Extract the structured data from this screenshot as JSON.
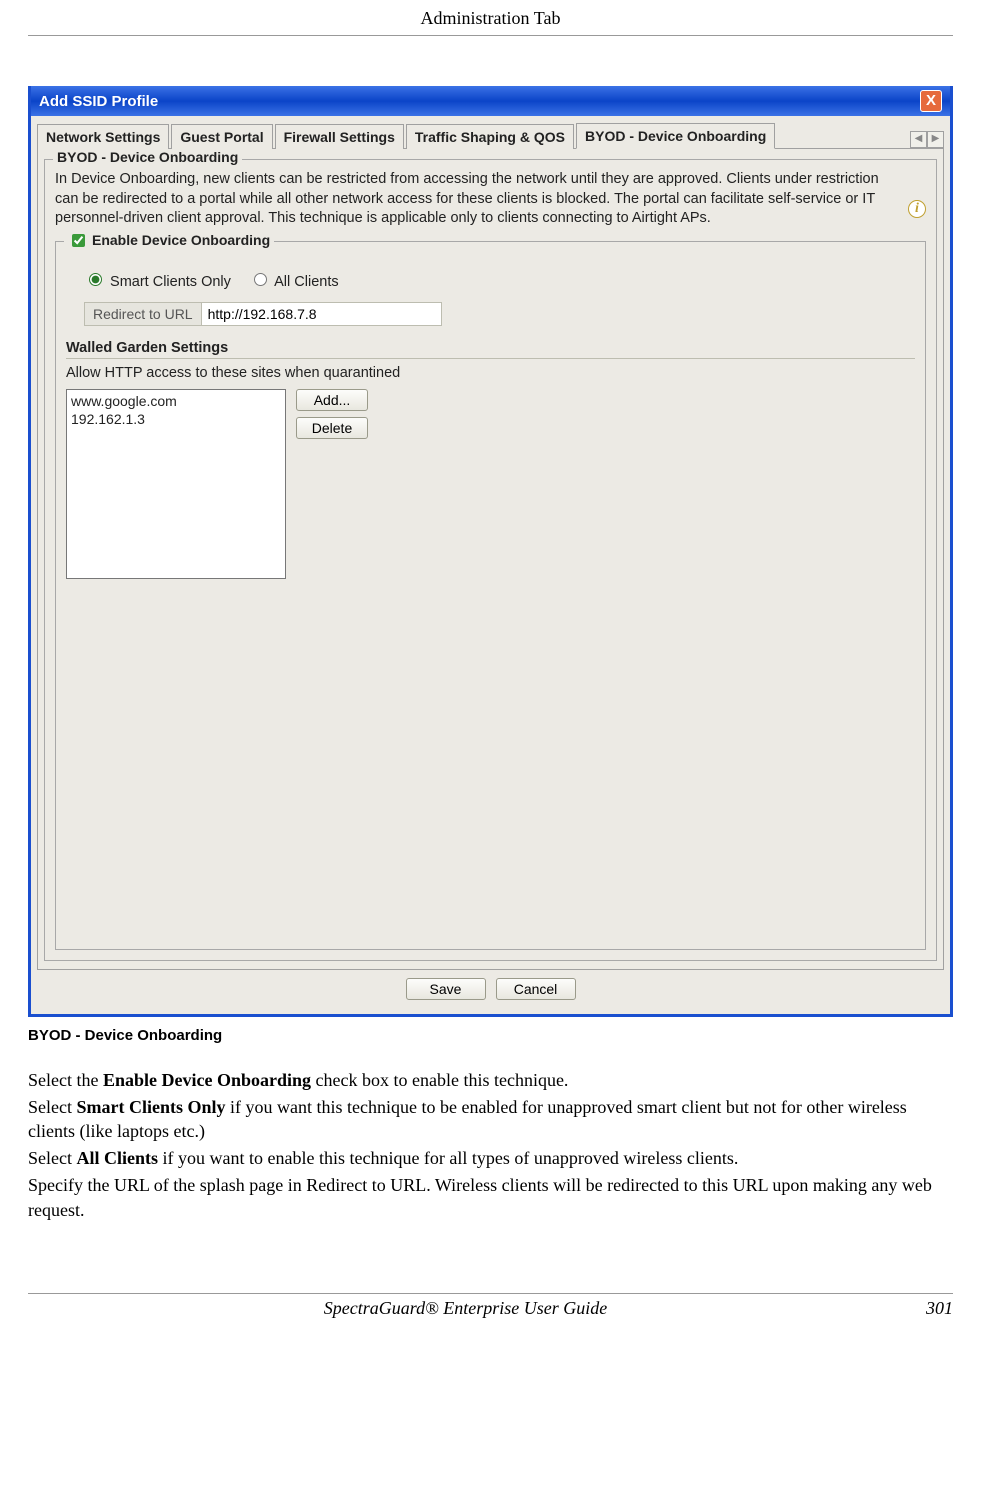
{
  "page_header": "Administration Tab",
  "dialog": {
    "title": "Add SSID Profile",
    "tabs": [
      "Network Settings",
      "Guest Portal",
      "Firewall Settings",
      "Traffic Shaping & QOS",
      "BYOD - Device Onboarding"
    ],
    "active_tab": "BYOD - Device Onboarding",
    "section_title": "BYOD - Device Onboarding",
    "description": "In Device Onboarding, new clients can be restricted from accessing the network until they are approved. Clients under restriction can be redirected to a portal while all other network access for these clients is blocked. The portal can facilitate self-service or IT personnel-driven client approval. This technique is applicable only to clients connecting to Airtight APs.",
    "enable_checkbox_label": "Enable Device Onboarding",
    "enable_checkbox_checked": true,
    "radios": {
      "smart_label": "Smart Clients Only",
      "all_label": "All Clients",
      "selected": "smart"
    },
    "redirect_label": "Redirect to URL",
    "redirect_value": "http://192.168.7.8",
    "walled": {
      "title": "Walled Garden Settings",
      "desc": "Allow HTTP access to these sites when quarantined",
      "sites": [
        "www.google.com",
        "192.162.1.3"
      ],
      "add_btn": "Add...",
      "delete_btn": "Delete"
    },
    "save_btn": "Save",
    "cancel_btn": "Cancel"
  },
  "caption": "BYOD - Device Onboarding",
  "doc_text": {
    "p1_a": "Select the ",
    "p1_b": "Enable Device Onboarding",
    "p1_c": " check box to enable this technique.",
    "p2_a": "Select ",
    "p2_b": "Smart Clients Only",
    "p2_c": " if you want this technique to be enabled for unapproved smart client but not for other wireless clients (like laptops etc.)",
    "p3_a": "Select ",
    "p3_b": "All Clients",
    "p3_c": " if you want to enable this technique for all types of unapproved wireless clients.",
    "p4": "Specify the URL of the splash page in Redirect to URL. Wireless clients will be redirected to this URL upon making any web request."
  },
  "footer": {
    "guide": "SpectraGuard® Enterprise User Guide",
    "page": "301"
  }
}
